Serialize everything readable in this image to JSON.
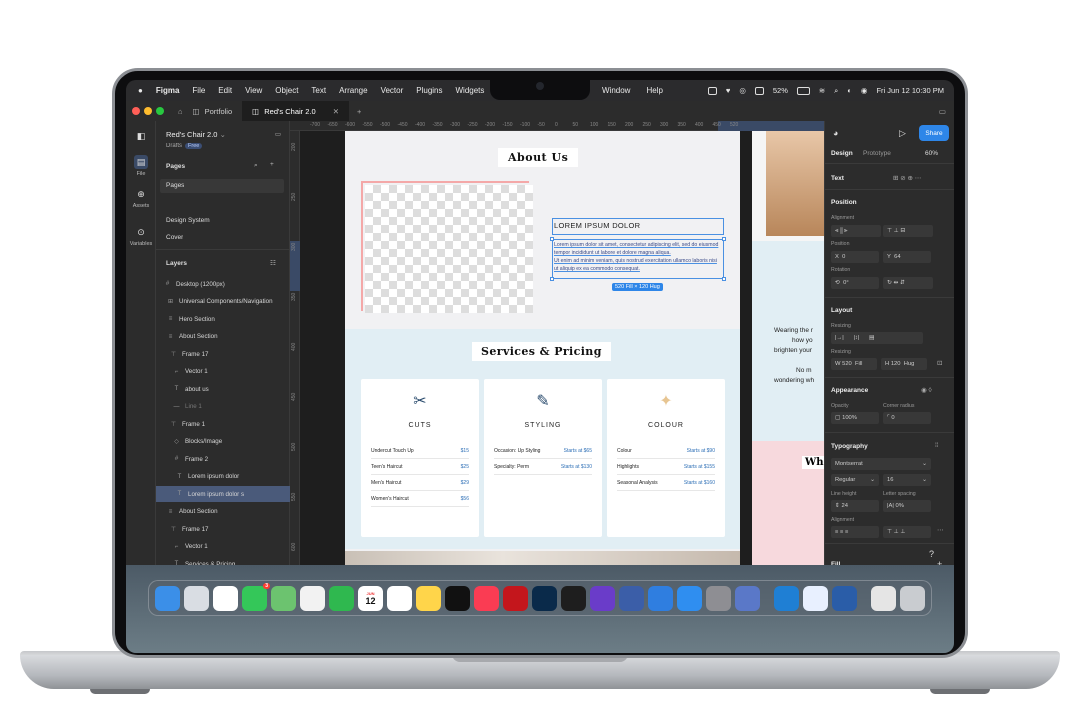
{
  "menubar": {
    "app": "Figma",
    "items": [
      "File",
      "Edit",
      "View",
      "Object",
      "Text",
      "Arrange",
      "Vector",
      "Plugins",
      "Widgets"
    ],
    "items2": [
      "Window",
      "Help"
    ],
    "battery": "52%",
    "datetime": "Fri Jun 12  10:30 PM"
  },
  "tabs": {
    "tab1": "Portfolio",
    "tab2": "Red's Chair 2.0"
  },
  "rail": {
    "file": "File",
    "assets": "Assets",
    "variables": "Variables"
  },
  "left": {
    "project": "Red's Chair 2.0",
    "drafts": "Drafts",
    "plan": "Free",
    "pages_label": "Pages",
    "pages": [
      "Pages",
      "Design System",
      "Cover"
    ],
    "layers_label": "Layers",
    "layers": [
      {
        "name": "Desktop (1200px)",
        "icon": "#"
      },
      {
        "name": "Universal Components/Navigation",
        "icon": "⊞"
      },
      {
        "name": "Hero Section",
        "icon": "≡"
      },
      {
        "name": "About Section",
        "icon": "≡"
      },
      {
        "name": "Frame 17",
        "icon": "⊤"
      },
      {
        "name": "Vector 1",
        "icon": "⌐"
      },
      {
        "name": "about us",
        "icon": "T"
      },
      {
        "name": "Line 1",
        "icon": "—"
      },
      {
        "name": "Frame 1",
        "icon": "⊤"
      },
      {
        "name": "Blocks/Image",
        "icon": "◇"
      },
      {
        "name": "Frame 2",
        "icon": "#"
      },
      {
        "name": "Lorem ipsum dolor",
        "icon": "T"
      },
      {
        "name": "Lorem ipsum dolor s",
        "icon": "T"
      },
      {
        "name": "About Section",
        "icon": "≡"
      },
      {
        "name": "Frame 17",
        "icon": "⊤"
      },
      {
        "name": "Vector 1",
        "icon": "⌐"
      },
      {
        "name": "Services & Pricing",
        "icon": "T"
      }
    ]
  },
  "ruler": {
    "h": [
      "-700",
      "-650",
      "-600",
      "-550",
      "-500",
      "-450",
      "-400",
      "-350",
      "-300",
      "-250",
      "-200",
      "-150",
      "-100",
      "-50",
      "0",
      "50",
      "100",
      "150",
      "200",
      "250",
      "300",
      "350",
      "400",
      "450",
      "520"
    ],
    "v": [
      "200",
      "250",
      "300",
      "350",
      "400",
      "450",
      "500",
      "550",
      "600",
      "650",
      "700"
    ]
  },
  "art": {
    "about_title": "About Us",
    "lorem_heading": "LOREM IPSUM DOLOR",
    "lorem_p1": "Lorem ipsum dolor sit amet, consectetur adipiscing elit, sed do eiusmod tempor incididunt ut labore et dolore magna aliqua.",
    "lorem_p2": "Ut enim ad minim veniam, quis nostrud exercitation ullamco laboris nisi ut aliquip ex ea commodo consequat.",
    "size_tag": "520 Fill × 120 Hug",
    "services_title": "Services & Pricing",
    "cards": [
      {
        "name": "CUTS",
        "icon": "✂",
        "rows": [
          [
            "Undercut Touch Up",
            "$15"
          ],
          [
            "Teen's Haircut",
            "$25"
          ],
          [
            "Men's Haircut",
            "$29"
          ],
          [
            "Women's Haircut",
            "$56"
          ]
        ]
      },
      {
        "name": "STYLING",
        "icon": "✎",
        "rows": [
          [
            "Occasion: Up Styling",
            "Starts at $65"
          ],
          [
            "Specialty: Perm",
            "Starts at $130"
          ]
        ]
      },
      {
        "name": "COLOUR",
        "icon": "✦",
        "rows": [
          [
            "Colour",
            "Starts at $90"
          ],
          [
            "Highlights",
            "Starts at $155"
          ],
          [
            "Seasonal Analysis",
            "Starts at $160"
          ]
        ]
      }
    ],
    "side_text": [
      "Wearing the r",
      "how yo",
      "brighten your",
      "",
      "No m",
      "wondering wh"
    ],
    "side_heading": "Wh"
  },
  "right": {
    "share": "Share",
    "tab_design": "Design",
    "tab_prototype": "Prototype",
    "zoom": "60%",
    "section": "Text",
    "position": "Position",
    "alignment": "Alignment",
    "position_label": "Position",
    "x": "0",
    "y": "64",
    "rotation_label": "Rotation",
    "rotation": "0°",
    "layout": "Layout",
    "resizing": "Resizing",
    "resizing2": "Resizing",
    "w": "520",
    "w_mode": "Fill",
    "h": "120",
    "h_mode": "Hug",
    "appearance": "Appearance",
    "opacity_label": "Opacity",
    "opacity": "100%",
    "radius_label": "Corner radius",
    "radius": "0",
    "typography": "Typography",
    "font": "Montserrat",
    "weight": "Regular",
    "size": "16",
    "lh_label": "Line height",
    "ls_label": "Letter spacing",
    "line_height": "24",
    "letter_spacing": "0%",
    "alignment2": "Alignment",
    "fill": "Fill"
  },
  "dock": {
    "apps": [
      {
        "name": "finder-icon",
        "color": "#3b8fe8"
      },
      {
        "name": "launchpad-icon",
        "color": "#d9dde3"
      },
      {
        "name": "chrome-icon",
        "color": "#ffffff"
      },
      {
        "name": "messages-icon",
        "color": "#34c759"
      },
      {
        "name": "maps-icon",
        "color": "#6cc36f"
      },
      {
        "name": "photos-icon",
        "color": "#f2f2f2"
      },
      {
        "name": "facetime-icon",
        "color": "#2fb84f"
      },
      {
        "name": "calendar-icon",
        "color": "#ffffff"
      },
      {
        "name": "reminders-icon",
        "color": "#ffffff"
      },
      {
        "name": "notes-icon",
        "color": "#ffd54a"
      },
      {
        "name": "appletv-icon",
        "color": "#111111"
      },
      {
        "name": "music-icon",
        "color": "#fa3c53"
      },
      {
        "name": "lastpass-icon",
        "color": "#c4161c"
      },
      {
        "name": "lightroom-icon",
        "color": "#0a2a4a"
      },
      {
        "name": "figma-icon",
        "color": "#1e1e1e"
      },
      {
        "name": "video-icon",
        "color": "#6a3cc9"
      },
      {
        "name": "arc-icon",
        "color": "#3b5ea8"
      },
      {
        "name": "keynote-icon",
        "color": "#2f7ee0"
      },
      {
        "name": "appstore-icon",
        "color": "#2f8ef0"
      },
      {
        "name": "settings-icon",
        "color": "#8e8e93"
      },
      {
        "name": "preview-icon",
        "color": "#5a78c8"
      },
      {
        "name": "vscode-icon",
        "color": "#1f7fd4"
      },
      {
        "name": "proxyman-icon",
        "color": "#e8f0ff"
      },
      {
        "name": "simulator-icon",
        "color": "#2a5da8"
      },
      {
        "name": "downloads-icon",
        "color": "#e5e5e5"
      },
      {
        "name": "trash-icon",
        "color": "#c9ccd0"
      }
    ],
    "calendar_day": "12",
    "calendar_month": "JUN",
    "messages_badge": "3"
  }
}
